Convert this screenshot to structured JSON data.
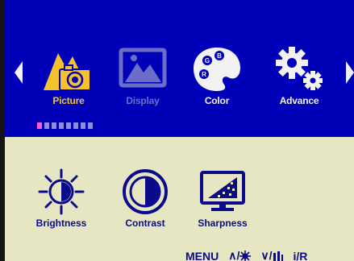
{
  "colors": {
    "menu_bg": "#0000b8",
    "panel_bg": "#e6e7c2",
    "active": "#f4c22f",
    "text": "#f2f2f2",
    "disabled": "#6b6dc7",
    "sub_text": "#0a0a8a",
    "page_indicator_on": "#ff5ad3",
    "page_indicator_off": "#8d8ce0"
  },
  "top_menu": {
    "items": [
      {
        "label": "Picture",
        "icon": "picture-mountain-camera-icon",
        "state": "selected"
      },
      {
        "label": "Display",
        "icon": "display-image-icon",
        "state": "disabled"
      },
      {
        "label": "Color",
        "icon": "palette-rgb-icon",
        "state": "normal"
      },
      {
        "label": "Advance",
        "icon": "gears-icon",
        "state": "normal"
      }
    ],
    "page_indicator": {
      "total": 8,
      "current": 1
    }
  },
  "sub_menu": {
    "items": [
      {
        "label": "Brightness",
        "icon": "sun-brightness-icon"
      },
      {
        "label": "Contrast",
        "icon": "contrast-circle-icon"
      },
      {
        "label": "Sharpness",
        "icon": "sharpness-monitor-icon"
      }
    ]
  },
  "key_hints": {
    "menu": "MENU",
    "up": "∧/",
    "down": "∨/",
    "input": "i/R"
  }
}
